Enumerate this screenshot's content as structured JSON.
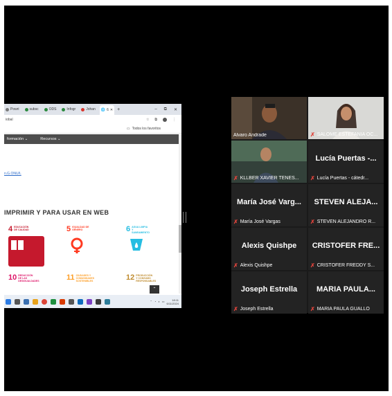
{
  "browser": {
    "tabs": [
      {
        "label": "Powri",
        "icon": "gray-dot"
      },
      {
        "label": "subsc",
        "icon": "green-dot"
      },
      {
        "label": "ODS",
        "icon": "green-dot"
      },
      {
        "label": "Infogr",
        "icon": "green-dot"
      },
      {
        "label": "Johan",
        "icon": "red-dot"
      },
      {
        "label": "6",
        "icon": "globe",
        "active": true
      }
    ],
    "new_tab": "+",
    "window_controls": [
      "–",
      "⧉",
      "✕"
    ],
    "address_text": "iobal",
    "bookmarks_label": "Todos los favoritos",
    "nav_items": [
      "formación",
      "Recursos"
    ],
    "link_text": "n.G.ONU/L",
    "heading": "IMPRIMIR Y PARA USAR EN WEB",
    "sdgs": [
      {
        "num": "4",
        "label": "EDUCACIÓN DE CALIDAD",
        "color": "#c5192d"
      },
      {
        "num": "5",
        "label": "IGUALDAD DE GÉNERO",
        "color": "#ff3a21"
      },
      {
        "num": "6",
        "label": "AGUA LIMPIA Y SANEAMIENTO",
        "color": "#26bde2"
      },
      {
        "num": "10",
        "label": "REDUCCIÓN DE LAS DESIGUALDADES",
        "color": "#dd1367"
      },
      {
        "num": "11",
        "label": "CIUDADES Y COMUNIDADES SOSTENIBLES",
        "color": "#fd9d24"
      },
      {
        "num": "12",
        "label": "PRODUCCIÓN Y CONSUMO RESPONSABLES",
        "color": "#bf8b2e"
      }
    ],
    "clock_time": "18:11",
    "clock_date": "6/11/2024"
  },
  "participants": [
    {
      "big": "",
      "name": "Alvaro Andrade",
      "muted": false,
      "video": true,
      "speaking": true
    },
    {
      "big": "",
      "name": "SALOME ESTEFANIA OC...",
      "muted": true,
      "video": true
    },
    {
      "big": "",
      "name": "KLLBER XAVIER TENES...",
      "muted": true,
      "video": true
    },
    {
      "big": "Lucía Puertas -...",
      "name": "Lucía Puertas - cátedr...",
      "muted": true,
      "video": false
    },
    {
      "big": "María José Varg...",
      "name": "María José Vargas",
      "muted": true,
      "video": false
    },
    {
      "big": "STEVEN ALEJA...",
      "name": "STEVEN ALEJANDRO R...",
      "muted": true,
      "video": false
    },
    {
      "big": "Alexis Quishpe",
      "name": "Alexis Quishpe",
      "muted": true,
      "video": false
    },
    {
      "big": "CRISTOFER FRE...",
      "name": "CRISTOFER FREDDY S...",
      "muted": true,
      "video": false
    },
    {
      "big": "Joseph Estrella",
      "name": "Joseph Estrella",
      "muted": true,
      "video": false
    },
    {
      "big": "MARIA PAULA...",
      "name": "MARIA PAULA GUALLO",
      "muted": true,
      "video": false
    }
  ],
  "mute_icon": "mic-off-icon",
  "colors": {
    "speaking_border": "#37c66f",
    "mute": "#e0443c",
    "gallery_bg": "#1a1a1a",
    "tile_bg": "#232323"
  }
}
